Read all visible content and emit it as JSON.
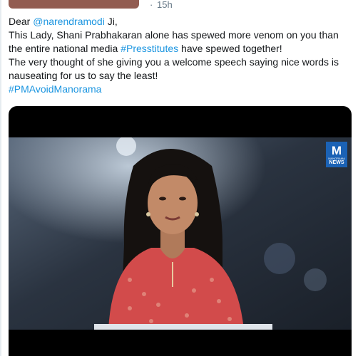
{
  "tweet": {
    "time_separator": "·",
    "timestamp": "15h",
    "greeting_prefix": "Dear ",
    "mention": "@narendramodi",
    "greeting_suffix": " Ji,",
    "line2_before": "This Lady, Shani Prabhakaran alone has spewed more venom on you than the entire national media ",
    "line2_hashtag": "#Presstitutes",
    "line2_after": " have spewed together!",
    "line3": "The very thought of she giving you a welcome speech saying nice words is nauseating for us to say the least!",
    "closing_hashtag": "#PMAvoidManorama"
  },
  "media": {
    "logo_mark": "M",
    "logo_small_text": "MANORAMA",
    "logo_news": "NEWS"
  },
  "colors": {
    "link": "#1b95e0",
    "logo_bg": "#1b62b5",
    "studio_bg": "#2a3340",
    "kurta": "#d24b4b",
    "redaction": "#7f3f33"
  }
}
